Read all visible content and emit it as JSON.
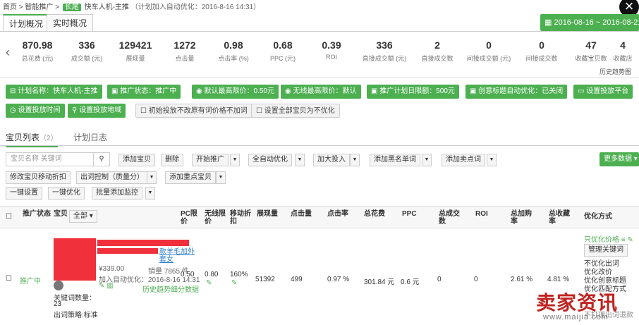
{
  "breadcrumb": {
    "home": "首页",
    "sep1": ">",
    "level2": "智能推广",
    "sep2": ">",
    "tag": "长尾",
    "title": "快车人机-主推",
    "note": "（计划加入自动优化：2016-8-16 14:31）"
  },
  "tabs": [
    "计划概况",
    "实时概况"
  ],
  "date_range": "2016-08-16 ~ 2016-08-21",
  "stats": [
    {
      "value": "870.98",
      "label": "总花费 (元)"
    },
    {
      "value": "336",
      "label": "成交额 (元)"
    },
    {
      "value": "129421",
      "label": "展现量"
    },
    {
      "value": "1272",
      "label": "点击量"
    },
    {
      "value": "0.98",
      "label": "点击率 (%)"
    },
    {
      "value": "0.68",
      "label": "PPC (元)"
    },
    {
      "value": "0.39",
      "label": "ROI"
    },
    {
      "value": "336",
      "label": "直接成交额 (元)"
    },
    {
      "value": "2",
      "label": "直接成交数"
    },
    {
      "value": "0",
      "label": "间接成交额 (元)"
    },
    {
      "value": "0",
      "label": "间接成交数"
    },
    {
      "value": "47",
      "label": "收藏宝贝数"
    },
    {
      "value": "4",
      "label": "收藏店"
    }
  ],
  "history": "历史趋势图",
  "settings_row1": [
    "计划名称：快车人机-主推",
    "推广状态：推广中",
    "默认最高限价：0.50元",
    "无线最高限价：默认",
    "推广计划日限额：500元",
    "创意标题自动优化：已关闭",
    "设置投放平台"
  ],
  "settings_row2_green": [
    "设置投放时间",
    "设置投放地域"
  ],
  "settings_row2_white": [
    "初始投放不改原有词价格不加词",
    "设置全部宝贝为不优化"
  ],
  "list_tabs": {
    "items": "宝贝列表",
    "count": "（2）",
    "log": "计划日志"
  },
  "search_placeholder": "宝贝名称 关键词",
  "toolbar1": [
    "添加宝贝",
    "删除",
    "开始推广",
    "全自动优化",
    "加大投入",
    "添加黑名单词",
    "添加卖点词"
  ],
  "more_data": "更多数据",
  "toolbar2": [
    "修改宝贝移动折扣",
    "出词控制（质量分）",
    "添加重点宝贝"
  ],
  "toolbar3": [
    "一键设置",
    "一键优化",
    "批量添加监控"
  ],
  "headers": {
    "status": "推广状态",
    "item": "宝贝",
    "all": "全部",
    "pc": "PC限价",
    "wireless": "无线限价",
    "mobile": "移动折扣",
    "impr": "展现量",
    "clicks": "点击量",
    "ctr": "点击率",
    "cost": "总花费",
    "ppc": "PPC",
    "deals": "总成交数",
    "roi": "ROI",
    "conv": "总加购率",
    "fav": "总收藏率",
    "opt": "优化方式"
  },
  "row": {
    "status": "推广中",
    "title_tail": "款羊毛加外套女",
    "price": "¥339.00",
    "sales": "销量 7865 件",
    "auto_opt": "加入自动优化：2016-8-16 14:31",
    "trend": "历史趋势",
    "detail": "细分数据",
    "kw_count_label": "关键词数量：",
    "kw_count": "23",
    "strategy": "出词策略:标准",
    "pc": "0.50",
    "wireless": "0.80",
    "mobile": "160%",
    "impr": "51392",
    "clicks": "499",
    "ctr": "0.97 %",
    "cost": "301.84 元",
    "ppc": "0.6 元",
    "deals": "0",
    "roi": "0",
    "conv": "2.61 %",
    "fav": "4.81 %",
    "opt_selected": "只优化价格",
    "manage_kw": "管理关键词",
    "opt_options": [
      "不优化出词",
      "优化改价",
      "优化创意标题",
      "优化匹配方式"
    ],
    "last_option": "不打理出词退款"
  },
  "watermark": {
    "text": "卖家资讯",
    "url": "www.maijia.com"
  },
  "colors": {
    "accent": "#4caf50",
    "mask": "#f0303a",
    "watermark": "#c0231f"
  }
}
